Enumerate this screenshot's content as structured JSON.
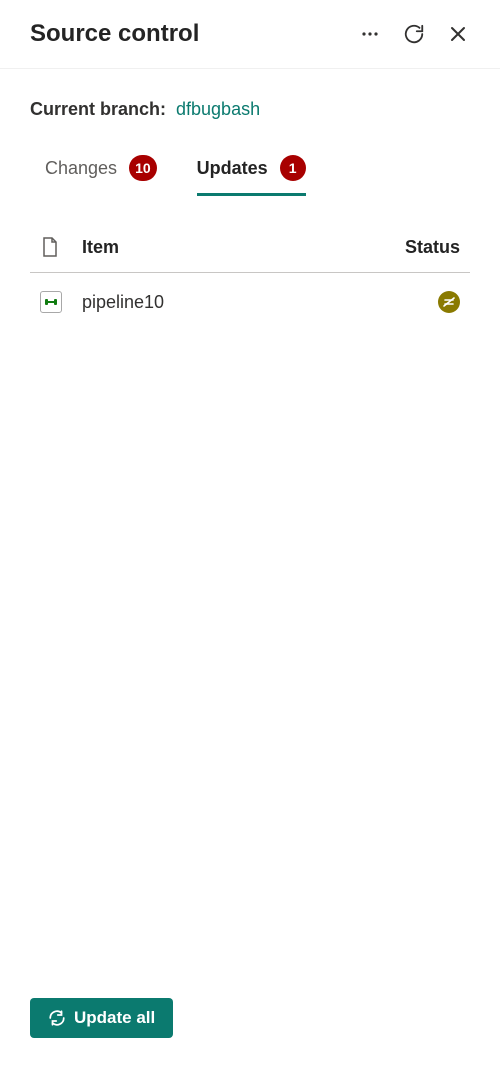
{
  "header": {
    "title": "Source control"
  },
  "branch": {
    "label": "Current branch:",
    "name": "dfbugbash"
  },
  "tabs": {
    "changes": {
      "label": "Changes",
      "count": "10"
    },
    "updates": {
      "label": "Updates",
      "count": "1"
    }
  },
  "table": {
    "headers": {
      "item": "Item",
      "status": "Status"
    },
    "rows": [
      {
        "name": "pipeline10",
        "type": "pipeline",
        "status": "incoming"
      }
    ]
  },
  "footer": {
    "update_all": "Update all"
  }
}
